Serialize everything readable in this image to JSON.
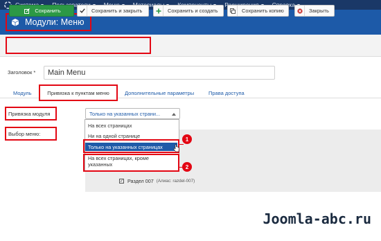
{
  "menubar": {
    "items": [
      "Система",
      "Пользователи",
      "Меню",
      "Материалы",
      "Компоненты",
      "Расширения",
      "Справка"
    ]
  },
  "header": {
    "title": "Модули: Меню"
  },
  "toolbar": {
    "save": "Сохранить",
    "save_close": "Сохранить и закрыть",
    "save_new": "Сохранить и создать",
    "save_copy": "Сохранить копию",
    "close": "Закрыть"
  },
  "form": {
    "title_label": "Заголовок *",
    "title_value": "Main Menu"
  },
  "tabs": [
    "Модуль",
    "Привязка к пунктам меню",
    "Дополнительные параметры",
    "Права доступа"
  ],
  "assignment": {
    "label": "Привязка модуля",
    "selected": "Только на указанных страни...",
    "options": [
      "На всех страницах",
      "Ни на одной странице",
      "Только на указанных страницах",
      "На всех страницах, кроме указанных"
    ],
    "menu_select_label": "Выбор меню:"
  },
  "menu_items": [
    {
      "label": "Раздел 007",
      "alias": "(Алиас: razdel-007)"
    }
  ],
  "annotations": [
    "1",
    "2"
  ],
  "watermark": "Joomla-abc.ru",
  "colors": {
    "menubar": "#1a3867",
    "titlebar": "#1d5aa8",
    "highlight": "#e30613",
    "save": "#2c9945"
  }
}
